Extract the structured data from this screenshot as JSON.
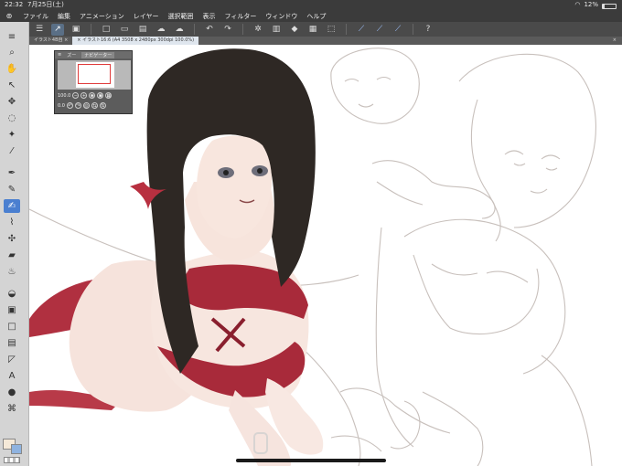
{
  "status": {
    "time": "22:32",
    "date": "7月25日(土)",
    "battery": "12%",
    "battery_level": 0.12
  },
  "menu": {
    "logo": "CLIP",
    "items": [
      "ファイル",
      "編集",
      "アニメーション",
      "レイヤー",
      "選択範囲",
      "表示",
      "フィルター",
      "ウィンドウ",
      "ヘルプ"
    ]
  },
  "tabs": {
    "inactive": "イラスト4B自 ×",
    "active": "× イラスト16:6 (A4 3508 x 2480px 300dpi 100.0%)",
    "close": "×"
  },
  "navigator": {
    "tab1": "ズー",
    "tab2": "ナビゲーター",
    "zoom": "100.0",
    "rotation": "0.0"
  },
  "colors": {
    "main_color": "#f5e9d8",
    "sub_color": "#8fb3e0",
    "accent": "#4a7fd0"
  }
}
